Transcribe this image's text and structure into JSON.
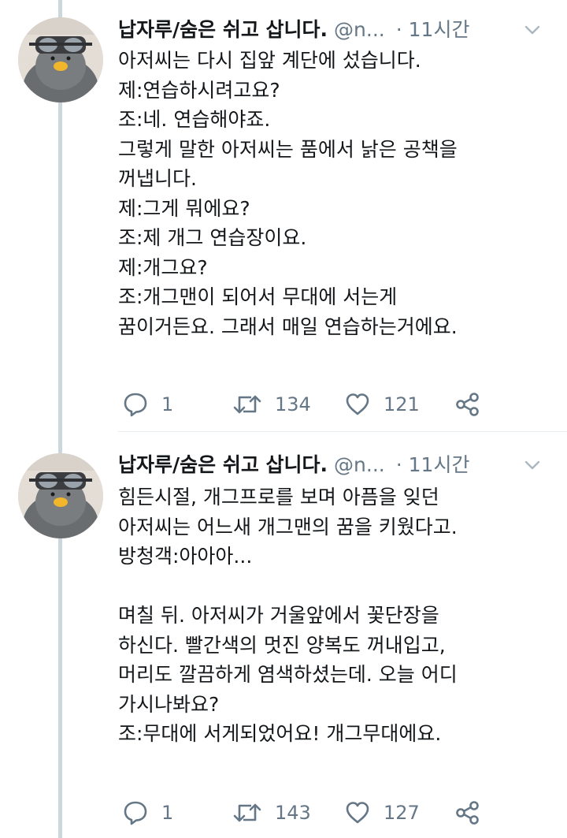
{
  "tweets": [
    {
      "display_name": "납자루/숨은 쉬고 삽니다.",
      "handle": "@n...",
      "time": "· 11시간",
      "avatar_icon": "penguin-with-goggles-avatar",
      "text": "아저씨는 다시 집앞 계단에 섰습니다.\n제:연습하시려고요?\n조:네. 연습해야죠.\n그렇게 말한 아저씨는 품에서 낡은 공책을\n꺼냅니다.\n제:그게 뭐에요?\n조:제 개그 연습장이요.\n제:개그요?\n조:개그맨이 되어서 무대에 서는게\n꿈이거든요. 그래서 매일 연습하는거에요.",
      "replies": "1",
      "retweets": "134",
      "likes": "121"
    },
    {
      "display_name": "납자루/숨은 쉬고 삽니다.",
      "handle": "@n...",
      "time": "· 11시간",
      "avatar_icon": "penguin-with-goggles-avatar",
      "text": "힘든시절, 개그프로를 보며 아픔을 잊던\n아저씨는 어느새 개그맨의 꿈을 키웠다고.\n방청객:아아아...\n\n며칠 뒤. 아저씨가 거울앞에서 꽃단장을\n하신다. 빨간색의 멋진 양복도 꺼내입고,\n머리도 깔끔하게 염색하셨는데. 오늘 어디\n가시나봐요?\n조:무대에 서게되었어요! 개그무대에요.",
      "replies": "1",
      "retweets": "143",
      "likes": "127"
    }
  ],
  "colors": {
    "text_primary": "#14171a",
    "text_secondary": "#657786",
    "thread_line": "#ccd6dd",
    "divider": "#e6ecf0"
  },
  "icons": {
    "reply": "reply-icon",
    "retweet": "retweet-icon",
    "like": "heart-icon",
    "share": "share-icon",
    "menu": "chevron-down-icon"
  }
}
